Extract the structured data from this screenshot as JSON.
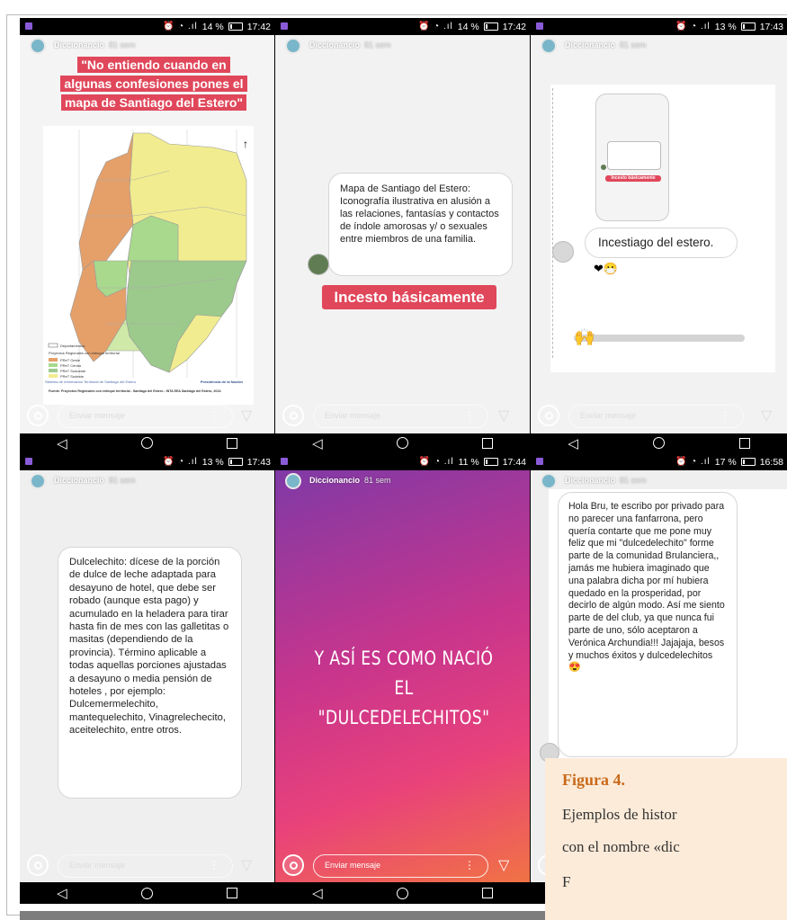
{
  "username": "Diccionancio",
  "time_ago": "81 sem",
  "reply_placeholder": "Enviar mensaje",
  "colors": {
    "story_red": "#e0475a",
    "caption_bg": "#fcebd9",
    "caption_title": "#c96a1a"
  },
  "panels": [
    {
      "status": {
        "battery": "14 %",
        "time": "17:42"
      },
      "red_caption": "\"No entiendo cuando en algunas confesiones pones el mapa de Santiago del Estero\"",
      "map_legend": {
        "items": [
          "Departamentos",
          "Proyectos Regionales con enfoque territorial",
          "PReT Oeste",
          "PReT Centro",
          "PReT Sudoeste",
          "PReT Sudeste"
        ]
      },
      "map_source": "Fuente: Proyectos Regionales con enfoque territorial - Santiago del Estero - INTA EEA Santiago del Estero, 2013.",
      "map_credit": "Sistema de Información Territorial de Santiago del Estero",
      "map_credit_right": "Presidencia de la Nación"
    },
    {
      "status": {
        "battery": "14 %",
        "time": "17:42"
      },
      "definition": "Mapa de Santiago del Estero: Iconografía ilustrativa en alusión a las relaciones, fantasías y contactos de índole amorosas y/ o sexuales entre miembros de una familia.",
      "sticker": "Incesto básicamente"
    },
    {
      "status": {
        "battery": "13 %",
        "time": "17:43"
      },
      "reply": "Incestiago del estero.",
      "reaction": "❤😷",
      "slider_emoji": "🙌",
      "mini_sticker": "Incesto básicamente"
    },
    {
      "status": {
        "battery": "13 %",
        "time": "17:43"
      },
      "definition": "Dulcelechito: dícese de la porción de dulce de leche adaptada para desayuno de hotel, que debe ser robado (aunque esta pago) y acumulado en la heladera para tirar hasta fin de mes con las galletitas o masitas (dependiendo de la provincia). Término aplicable a todas aquellas porciones ajustadas a desayuno o media pensión de hoteles , por ejemplo: Dulcemermelechito, mantequelechito, Vinagrelechecito, aceitelechito, entre otros."
    },
    {
      "status": {
        "battery": "11 %",
        "time": "17:44"
      },
      "headline": "Y ASÍ ES COMO NACIÓ EL \"DULCEDELECHITOS\""
    },
    {
      "status": {
        "battery": "17 %",
        "time": "16:58"
      },
      "message": "Hola Bru, te escribo por privado para no parecer una fanfarrona, pero quería contarte que me pone muy feliz que mi \"dulcedelechito\" forme parte de la comunidad Brulanciera,, jamás me hubiera imaginado que una palabra dicha por mí hubiera quedado en la prosperidad, por decirlo de algún modo. Así me siento parte de del club, ya que nunca fui parte de uno, sólo aceptaron a Verónica Archundia!!! Jajajaja, besos y muchos éxitos y dulcedelechitos",
      "emoji": "😍"
    }
  ],
  "caption": {
    "title": "Figura 4.",
    "line1": "Ejemplos de histor",
    "line2": "con el nombre «dic",
    "line3": "F"
  }
}
